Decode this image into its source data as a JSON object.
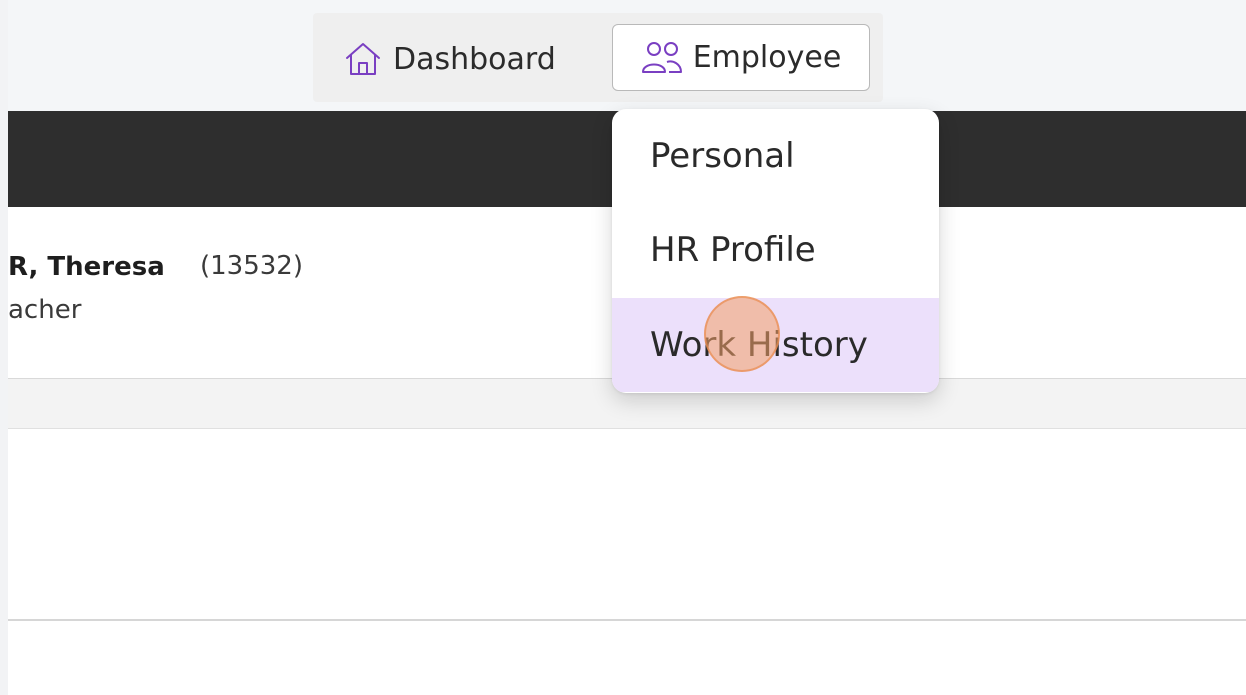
{
  "nav": {
    "dashboard_label": "Dashboard",
    "dashboard_icon": "home-icon",
    "employee_label": "Employee",
    "employee_icon": "users-icon",
    "accent_color": "#7a3fc2"
  },
  "employee": {
    "name": "R, Theresa",
    "id": "(13532)",
    "title": "acher"
  },
  "employee_menu": {
    "items": [
      {
        "label": "Personal"
      },
      {
        "label": "HR Profile"
      },
      {
        "label": "Work History"
      }
    ],
    "highlight_color": "#ece0fb"
  }
}
